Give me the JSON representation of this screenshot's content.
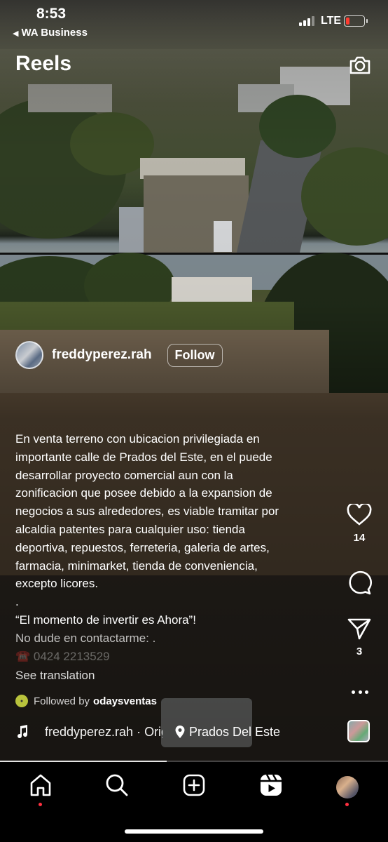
{
  "status_bar": {
    "time": "8:53",
    "back_app": "WA Business",
    "network": "LTE"
  },
  "header": {
    "title": "Reels",
    "camera_icon": "camera-icon"
  },
  "reel": {
    "author": {
      "username": "freddyperez.rah",
      "follow_label": "Follow"
    },
    "caption": {
      "lines": [
        "En venta terreno con ubicacion privilegiada en",
        "importante calle de Prados del Este, en el puede",
        "desarrollar proyecto comercial aun con la",
        "zonificacion que posee debido a la expansion de",
        "negocios a sus alrededores, es viable tramitar por",
        "alcaldia patentes para cualquier uso: tienda",
        "deportiva, repuestos, ferreteria, galeria de artes,",
        "farmacia, minimarket, tienda de conveniencia,",
        "excepto licores."
      ],
      "dot": ".",
      "quote": "“El momento de invertir es Ahora”!",
      "contact": "No dude en contactarme: .",
      "phone": "☎️ 0424 2213529"
    },
    "see_translation": "See translation",
    "followed_by_prefix": "Followed by",
    "followed_by_user": "odaysventas",
    "audio": {
      "text": "freddyperez.rah · Original audio",
      "location": "Prados Del Este"
    },
    "actions": {
      "likes": "14",
      "shares": "3"
    },
    "progress": 0.43
  },
  "bottom_nav": {
    "items": [
      "home-icon",
      "search-icon",
      "create-icon",
      "reels-icon",
      "profile-avatar"
    ]
  }
}
